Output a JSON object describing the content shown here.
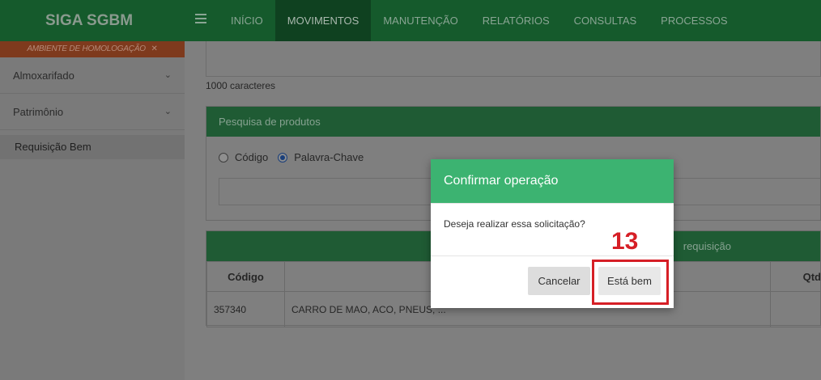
{
  "app": {
    "title": "SIGA SGBM"
  },
  "nav": {
    "items": [
      {
        "label": "INÍCIO",
        "active": false
      },
      {
        "label": "MOVIMENTOS",
        "active": true
      },
      {
        "label": "MANUTENÇÃO",
        "active": false
      },
      {
        "label": "RELATÓRIOS",
        "active": false
      },
      {
        "label": "CONSULTAS",
        "active": false
      },
      {
        "label": "PROCESSOS",
        "active": false
      }
    ]
  },
  "sidebar": {
    "env_banner": "AMBIENTE DE HOMOLOGAÇÃO",
    "groups": [
      {
        "label": "Almoxarifado"
      },
      {
        "label": "Patrimônio"
      }
    ],
    "sub_item": "Requisição Bem"
  },
  "main": {
    "chars_hint": "1000 caracteres",
    "search_panel": {
      "title": "Pesquisa de produtos",
      "options": [
        {
          "label": "Código",
          "selected": false
        },
        {
          "label": "Palavra-Chave",
          "selected": true
        }
      ],
      "search_value": ""
    },
    "items_panel": {
      "title_partial": "requisição",
      "columns": [
        "Código",
        "",
        "Qtd"
      ],
      "rows": [
        {
          "codigo": "357340",
          "descricao": "CARRO DE MAO, ACO, PNEUS, ..."
        }
      ]
    }
  },
  "modal": {
    "title": "Confirmar operação",
    "message": "Deseja realizar essa solicitação?",
    "cancel_label": "Cancelar",
    "ok_label": "Está bem"
  },
  "annotation": {
    "step_number": "13",
    "color": "#d61f26"
  },
  "colors": {
    "header_green": "#155a2c",
    "modal_header": "#3cb371",
    "env_banner": "#c0562d"
  }
}
